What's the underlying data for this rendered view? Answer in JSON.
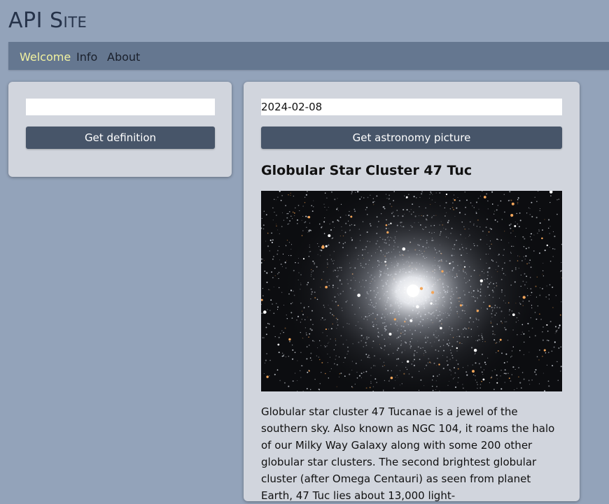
{
  "site": {
    "title": "API Site"
  },
  "nav": {
    "items": [
      {
        "label": "Welcome",
        "active": true
      },
      {
        "label": "Info",
        "active": false
      },
      {
        "label": "About",
        "active": false
      }
    ]
  },
  "definition": {
    "input_value": "",
    "button_label": "Get definition"
  },
  "apod": {
    "date_value": "2024-02-08",
    "button_label": "Get astronomy picture",
    "title": "Globular Star Cluster 47 Tuc",
    "description": "Globular star cluster 47 Tucanae is a jewel of the southern sky. Also known as NGC 104, it roams the halo of our Milky Way Galaxy along with some 200 other globular star clusters. The second brightest globular cluster (after Omega Centauri) as seen from planet Earth, 47 Tuc lies about 13,000 light-"
  },
  "colors": {
    "background": "#93a3ba",
    "navbar": "#657790",
    "nav_active": "#f2f2a0",
    "card": "#d1d5dd",
    "button": "#475569"
  }
}
